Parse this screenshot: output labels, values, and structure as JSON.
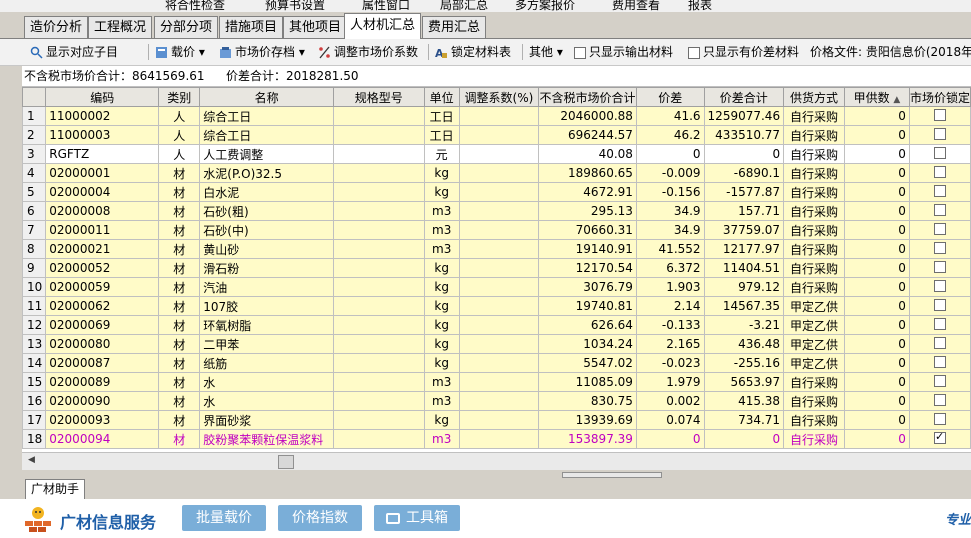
{
  "top_menu": {
    "items": [
      "将合性检查",
      "预算书设置",
      "属性窗口",
      "局部汇总",
      "多方案报价",
      "费用查看",
      "报表"
    ]
  },
  "tabs": [
    {
      "label": "造价分析"
    },
    {
      "label": "工程概况"
    },
    {
      "label": "分部分项"
    },
    {
      "label": "措施项目"
    },
    {
      "label": "其他项目"
    },
    {
      "label": "人材机汇总",
      "active": true
    },
    {
      "label": "费用汇总"
    }
  ],
  "toolbar": {
    "show_sub": "显示对应子目",
    "load_price": "载价",
    "market_doc": "市场价存档",
    "adjust_coef": "调整市场价系数",
    "lock_material": "锁定材料表",
    "other": "其他",
    "only_output": "只显示输出材料",
    "only_diff": "只显示有价差材料",
    "price_file": "价格文件: 贵阳信息价(2018年("
  },
  "summary": {
    "total_label": "不含税市场价合计：8641569.61",
    "diff_label": "价差合计：2018281.50"
  },
  "table": {
    "headers": [
      "编码",
      "类别",
      "名称",
      "规格型号",
      "单位",
      "调整系数(%)",
      "不含税市场价合计",
      "价差",
      "价差合计",
      "供货方式",
      "甲供数",
      "市场价锁定"
    ],
    "rows": [
      {
        "n": "1",
        "code": "11000002",
        "type": "人",
        "name": "综合工日",
        "spec": "",
        "unit": "工日",
        "coef": "",
        "total": "2046000.88",
        "diff": "41.6",
        "diffsum": "1259077.46",
        "supply": "自行采购",
        "jia": "0",
        "locked": false,
        "style": "yel"
      },
      {
        "n": "2",
        "code": "11000003",
        "type": "人",
        "name": "综合工日",
        "spec": "",
        "unit": "工日",
        "coef": "",
        "total": "696244.57",
        "diff": "46.2",
        "diffsum": "433510.77",
        "supply": "自行采购",
        "jia": "0",
        "locked": false,
        "style": "yel"
      },
      {
        "n": "3",
        "code": "RGFTZ",
        "type": "人",
        "name": "人工费调整",
        "spec": "",
        "unit": "元",
        "coef": "",
        "total": "40.08",
        "diff": "0",
        "diffsum": "0",
        "supply": "自行采购",
        "jia": "0",
        "locked": false,
        "style": "wht"
      },
      {
        "n": "4",
        "code": "02000001",
        "type": "材",
        "name": "水泥(P.O)32.5",
        "spec": "",
        "unit": "kg",
        "coef": "",
        "total": "189860.65",
        "diff": "-0.009",
        "diffsum": "-6890.1",
        "supply": "自行采购",
        "jia": "0",
        "locked": false,
        "style": "yel"
      },
      {
        "n": "5",
        "code": "02000004",
        "type": "材",
        "name": "白水泥",
        "spec": "",
        "unit": "kg",
        "coef": "",
        "total": "4672.91",
        "diff": "-0.156",
        "diffsum": "-1577.87",
        "supply": "自行采购",
        "jia": "0",
        "locked": false,
        "style": "yel"
      },
      {
        "n": "6",
        "code": "02000008",
        "type": "材",
        "name": "石砂(粗)",
        "spec": "",
        "unit": "m3",
        "coef": "",
        "total": "295.13",
        "diff": "34.9",
        "diffsum": "157.71",
        "supply": "自行采购",
        "jia": "0",
        "locked": false,
        "style": "yel"
      },
      {
        "n": "7",
        "code": "02000011",
        "type": "材",
        "name": "石砂(中)",
        "spec": "",
        "unit": "m3",
        "coef": "",
        "total": "70660.31",
        "diff": "34.9",
        "diffsum": "37759.07",
        "supply": "自行采购",
        "jia": "0",
        "locked": false,
        "style": "yel"
      },
      {
        "n": "8",
        "code": "02000021",
        "type": "材",
        "name": "黄山砂",
        "spec": "",
        "unit": "m3",
        "coef": "",
        "total": "19140.91",
        "diff": "41.552",
        "diffsum": "12177.97",
        "supply": "自行采购",
        "jia": "0",
        "locked": false,
        "style": "yel"
      },
      {
        "n": "9",
        "code": "02000052",
        "type": "材",
        "name": "滑石粉",
        "spec": "",
        "unit": "kg",
        "coef": "",
        "total": "12170.54",
        "diff": "6.372",
        "diffsum": "11404.51",
        "supply": "自行采购",
        "jia": "0",
        "locked": false,
        "style": "yel"
      },
      {
        "n": "10",
        "code": "02000059",
        "type": "材",
        "name": "汽油",
        "spec": "",
        "unit": "kg",
        "coef": "",
        "total": "3076.79",
        "diff": "1.903",
        "diffsum": "979.12",
        "supply": "自行采购",
        "jia": "0",
        "locked": false,
        "style": "yel"
      },
      {
        "n": "11",
        "code": "02000062",
        "type": "材",
        "name": "107胶",
        "spec": "",
        "unit": "kg",
        "coef": "",
        "total": "19740.81",
        "diff": "2.14",
        "diffsum": "14567.35",
        "supply": "甲定乙供",
        "jia": "0",
        "locked": false,
        "style": "yel"
      },
      {
        "n": "12",
        "code": "02000069",
        "type": "材",
        "name": "环氧树脂",
        "spec": "",
        "unit": "kg",
        "coef": "",
        "total": "626.64",
        "diff": "-0.133",
        "diffsum": "-3.21",
        "supply": "甲定乙供",
        "jia": "0",
        "locked": false,
        "style": "yel"
      },
      {
        "n": "13",
        "code": "02000080",
        "type": "材",
        "name": "二甲苯",
        "spec": "",
        "unit": "kg",
        "coef": "",
        "total": "1034.24",
        "diff": "2.165",
        "diffsum": "436.48",
        "supply": "甲定乙供",
        "jia": "0",
        "locked": false,
        "style": "yel"
      },
      {
        "n": "14",
        "code": "02000087",
        "type": "材",
        "name": "纸筋",
        "spec": "",
        "unit": "kg",
        "coef": "",
        "total": "5547.02",
        "diff": "-0.023",
        "diffsum": "-255.16",
        "supply": "甲定乙供",
        "jia": "0",
        "locked": false,
        "style": "yel"
      },
      {
        "n": "15",
        "code": "02000089",
        "type": "材",
        "name": "水",
        "spec": "",
        "unit": "m3",
        "coef": "",
        "total": "11085.09",
        "diff": "1.979",
        "diffsum": "5653.97",
        "supply": "自行采购",
        "jia": "0",
        "locked": false,
        "style": "yel"
      },
      {
        "n": "16",
        "code": "02000090",
        "type": "材",
        "name": "水",
        "spec": "",
        "unit": "m3",
        "coef": "",
        "total": "830.75",
        "diff": "0.002",
        "diffsum": "415.38",
        "supply": "自行采购",
        "jia": "0",
        "locked": false,
        "style": "yel"
      },
      {
        "n": "17",
        "code": "02000093",
        "type": "材",
        "name": "界面砂浆",
        "spec": "",
        "unit": "kg",
        "coef": "",
        "total": "13939.69",
        "diff": "0.074",
        "diffsum": "734.71",
        "supply": "自行采购",
        "jia": "0",
        "locked": false,
        "style": "yel"
      },
      {
        "n": "18",
        "code": "02000094",
        "type": "材",
        "name": "胶粉聚苯颗粒保温浆料",
        "spec": "",
        "unit": "m3",
        "coef": "",
        "total": "153897.39",
        "diff": "0",
        "diffsum": "0",
        "supply": "自行采购",
        "jia": "0",
        "locked": true,
        "style": "pink"
      }
    ]
  },
  "helper_tab": "广材助手",
  "bottom": {
    "brand": "广材信息服务",
    "batch_load": "批量载价",
    "price_index": "价格指数",
    "toolbox": "工具箱",
    "corner_text": "专业"
  }
}
